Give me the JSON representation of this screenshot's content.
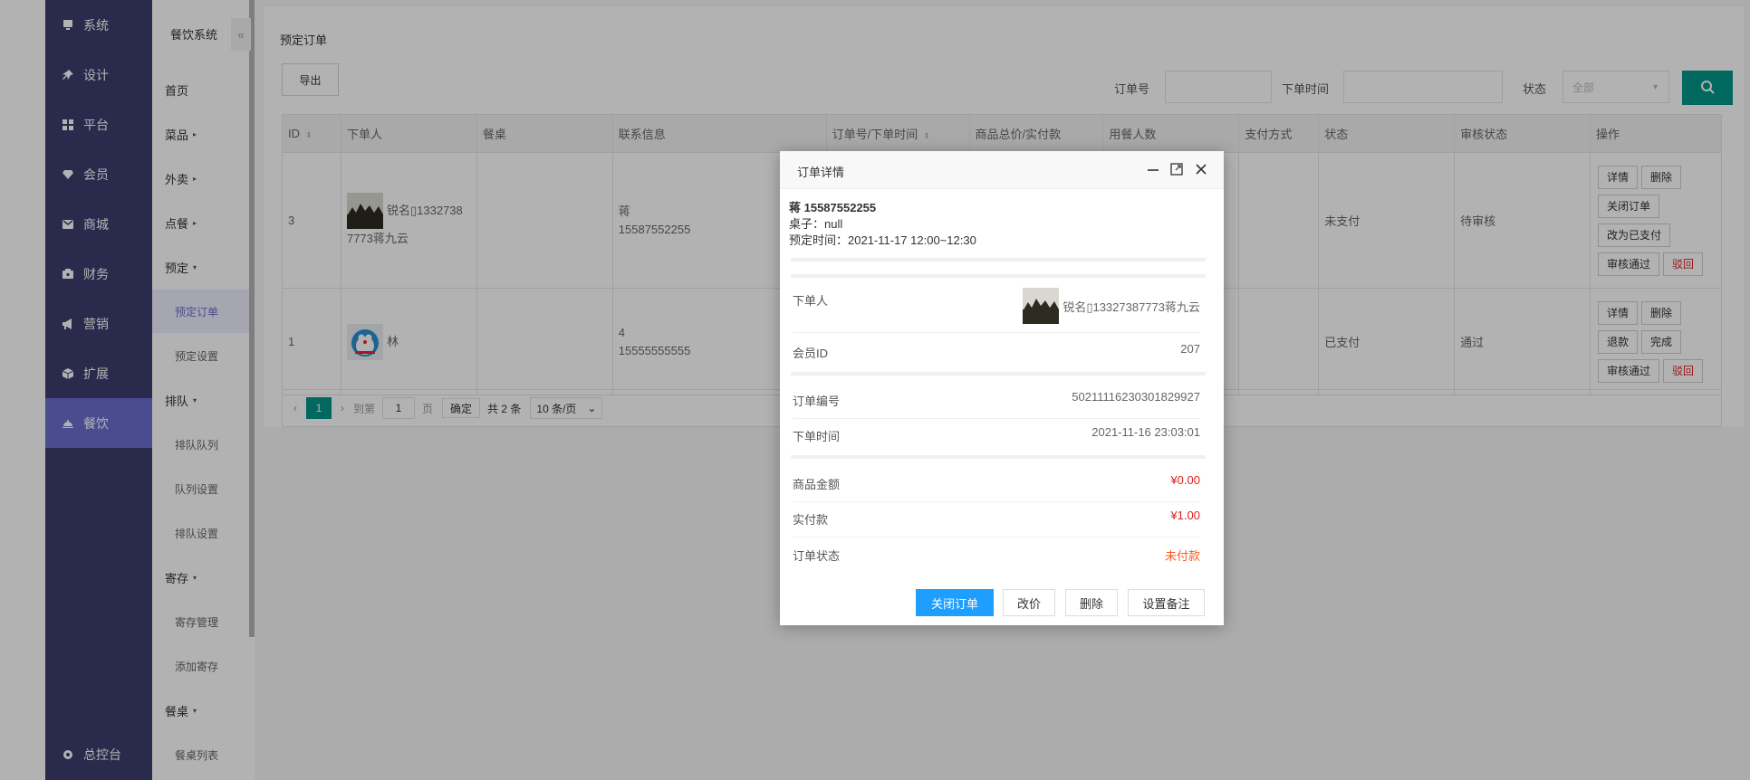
{
  "main_nav": [
    {
      "label": "系统",
      "icon": "monitor-icon"
    },
    {
      "label": "设计",
      "icon": "pin-icon"
    },
    {
      "label": "平台",
      "icon": "grid-icon"
    },
    {
      "label": "会员",
      "icon": "diamond-icon"
    },
    {
      "label": "商城",
      "icon": "mail-icon"
    },
    {
      "label": "财务",
      "icon": "wallet-icon"
    },
    {
      "label": "营销",
      "icon": "megaphone-icon"
    },
    {
      "label": "扩展",
      "icon": "cube-icon"
    },
    {
      "label": "餐饮",
      "icon": "cloche-icon",
      "active": true
    }
  ],
  "console_label": "总控台",
  "sub_nav": {
    "title": "餐饮系统",
    "collapse": "«",
    "items": [
      {
        "label": "首页"
      },
      {
        "label": "菜品",
        "caret": "▸"
      },
      {
        "label": "外卖",
        "caret": "▸"
      },
      {
        "label": "点餐",
        "caret": "▸"
      },
      {
        "label": "预定",
        "caret": "▾"
      },
      {
        "label": "预定订单",
        "child": true,
        "active": true
      },
      {
        "label": "预定设置",
        "child": true
      },
      {
        "label": "排队",
        "caret": "▾"
      },
      {
        "label": "排队队列",
        "child": true
      },
      {
        "label": "队列设置",
        "child": true
      },
      {
        "label": "排队设置",
        "child": true
      },
      {
        "label": "寄存",
        "caret": "▾"
      },
      {
        "label": "寄存管理",
        "child": true
      },
      {
        "label": "添加寄存",
        "child": true
      },
      {
        "label": "餐桌",
        "caret": "▾"
      },
      {
        "label": "餐桌列表",
        "child": true
      }
    ]
  },
  "page": {
    "title": "预定订单",
    "export_label": "导出",
    "filters": {
      "order_no_label": "订单号",
      "order_time_label": "下单时间",
      "status_label": "状态",
      "status_value": "全部"
    }
  },
  "table": {
    "headers": [
      "ID",
      "下单人",
      "餐桌",
      "联系信息",
      "订单号/下单时间",
      "商品总价/实付款",
      "用餐人数",
      "支付方式",
      "状态",
      "审核状态",
      "操作"
    ],
    "rows": [
      {
        "id": "3",
        "buyer_line1": "锐名▯1332738",
        "buyer_line2": "7773蒋九云",
        "table": "",
        "contact_name": "蒋",
        "contact_phone": "15587552255",
        "status": "未支付",
        "audit": "待审核",
        "ops": [
          "详情",
          "删除",
          "关闭订单",
          "改为已支付",
          "审核通过",
          "驳回"
        ]
      },
      {
        "id": "1",
        "buyer_line1": "林",
        "buyer_line2": "",
        "table": "",
        "contact_name": "4",
        "contact_phone": "15555555555",
        "status": "已支付",
        "audit": "通过",
        "ops": [
          "详情",
          "删除",
          "退款",
          "完成",
          "审核通过",
          "驳回"
        ]
      }
    ]
  },
  "pager": {
    "current": "1",
    "goto_label": "到第",
    "goto_value": "1",
    "page_label": "页",
    "confirm_label": "确定",
    "total_label": "共 2 条",
    "per_page": "10 条/页"
  },
  "modal": {
    "title": "订单详情",
    "contact_line": "蒋 15587552255",
    "table_line": "桌子：null",
    "reserve_line": "预定时间：2021-11-17 12:00~12:30",
    "buyer_label": "下单人",
    "buyer_value": "锐名▯13327387773蒋九云",
    "member_id_label": "会员ID",
    "member_id_value": "207",
    "order_no_label": "订单编号",
    "order_no_value": "50211116230301829927",
    "order_time_label": "下单时间",
    "order_time_value": "2021-11-16 23:03:01",
    "goods_amount_label": "商品金额",
    "goods_amount_value": "¥0.00",
    "paid_label": "实付款",
    "paid_value": "¥1.00",
    "status_label": "订单状态",
    "status_value": "未付款",
    "buttons": {
      "close_order": "关闭订单",
      "change_price": "改价",
      "delete": "删除",
      "set_remark": "设置备注"
    }
  },
  "colors": {
    "nav_bg": "#3b3d6e",
    "nav_active": "#6a6ecf",
    "primary_teal": "#009688",
    "primary_blue": "#1e9fff",
    "danger": "#e02020",
    "warn": "#ff5722"
  }
}
